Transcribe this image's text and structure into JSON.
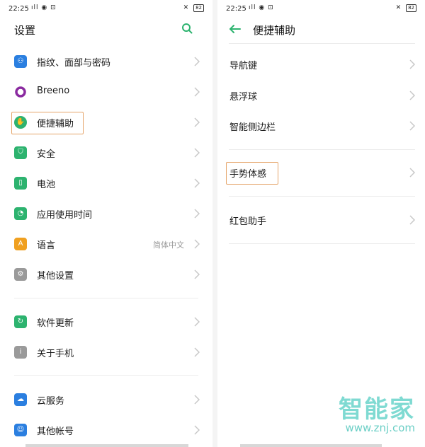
{
  "colors": {
    "accent_green": "#2db36f",
    "highlight_orange": "#e5a56a",
    "chevron": "#c8c8c8",
    "watermark": "#7fdad2"
  },
  "left": {
    "status": {
      "time": "22:25",
      "signal": "ıll  ◉ ⊡",
      "right_icons": "✕",
      "battery": "82"
    },
    "title": "设置",
    "items": [
      {
        "label": "指纹、面部与密码",
        "icon": "face-id-icon",
        "color": "#2b7fe0"
      },
      {
        "label": "Breeno",
        "icon": "breeno-icon",
        "color": "#8a2aa0"
      },
      {
        "label": "便捷辅助",
        "icon": "assist-hand-icon",
        "color": "#2db36f"
      },
      {
        "label": "安全",
        "icon": "shield-icon",
        "color": "#2db36f"
      },
      {
        "label": "电池",
        "icon": "battery-icon",
        "color": "#2db36f"
      },
      {
        "label": "应用使用时间",
        "icon": "app-time-icon",
        "color": "#2db36f"
      },
      {
        "label": "语言",
        "value": "简体中文",
        "icon": "language-icon",
        "color": "#f0a020"
      },
      {
        "label": "其他设置",
        "icon": "other-settings-icon",
        "color": "#9a9a9a"
      },
      {
        "label": "软件更新",
        "icon": "update-icon",
        "color": "#2db36f"
      },
      {
        "label": "关于手机",
        "icon": "info-icon",
        "color": "#9a9a9a"
      },
      {
        "label": "云服务",
        "icon": "cloud-icon",
        "color": "#2b7fe0"
      },
      {
        "label": "其他帐号",
        "icon": "account-icon",
        "color": "#2b7fe0"
      }
    ]
  },
  "right": {
    "status": {
      "time": "22:25",
      "signal": "ıll  ◉ ⊡",
      "right_icons": "✕",
      "battery": "82"
    },
    "title": "便捷辅助",
    "items": [
      {
        "label": "导航键"
      },
      {
        "label": "悬浮球"
      },
      {
        "label": "智能侧边栏"
      },
      {
        "label": "手势体感"
      },
      {
        "label": "红包助手"
      }
    ]
  },
  "watermark": {
    "brand": "智能家",
    "url": "www.znj.com"
  }
}
